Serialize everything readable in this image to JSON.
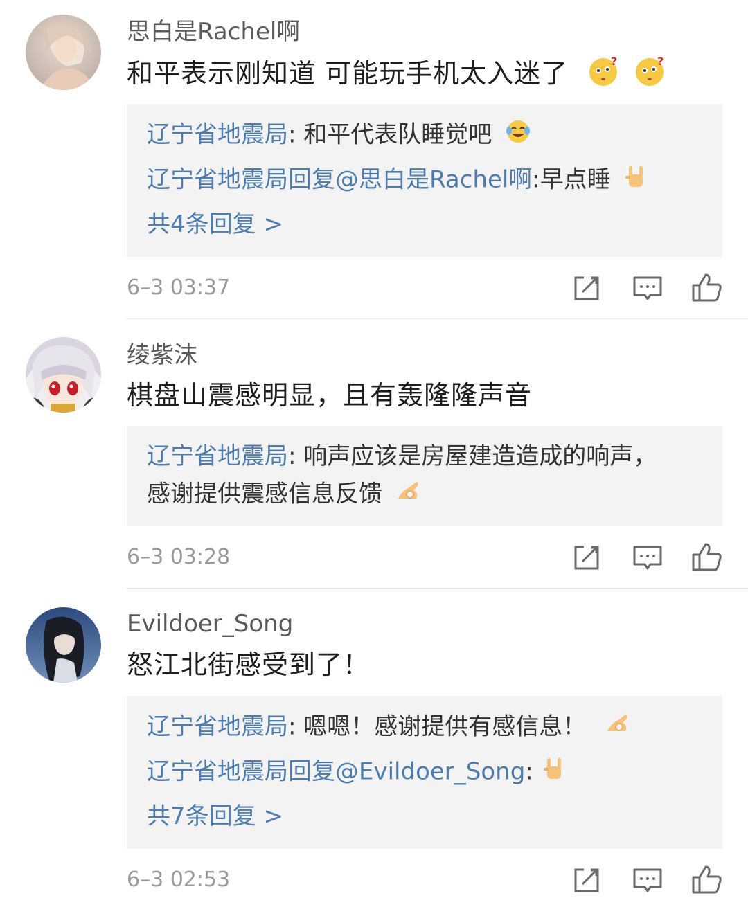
{
  "comments": [
    {
      "username": "思白是Rachel啊",
      "text": "和平表示刚知道  可能玩手机太入迷了",
      "replies": [
        {
          "name": "辽宁省地震局",
          "text": ": 和平代表队睡觉吧"
        },
        {
          "name": "辽宁省地震局回复@思白是Rachel啊",
          "text": ":早点睡"
        }
      ],
      "more_replies": "共4条回复 >",
      "timestamp": "6–3 03:37"
    },
    {
      "username": "绫紫沫",
      "text": "棋盘山震感明显，且有轰隆隆声音",
      "replies": [
        {
          "name": "辽宁省地震局",
          "text": ": 响声应该是房屋建造造成的响声，"
        },
        {
          "name": "",
          "text": "感谢提供震感信息反馈"
        }
      ],
      "timestamp": "6–3 03:28"
    },
    {
      "username": "Evildoer_Song",
      "text": "怒江北街感受到了！",
      "replies": [
        {
          "name": "辽宁省地震局",
          "text": ": 嗯嗯！感谢提供有感信息！"
        },
        {
          "name": "辽宁省地震局回复@Evildoer_Song",
          "text": ":"
        }
      ],
      "more_replies": "共7条回复 >",
      "timestamp": "6–3 02:53"
    }
  ],
  "icons": {
    "repost": "repost-icon",
    "comment": "comment-icon",
    "like": "thumbs-up-icon",
    "emojis": [
      "confused-face-emoji",
      "laughing-tears-emoji",
      "rock-hand-emoji",
      "ok-hand-emoji"
    ]
  },
  "colors": {
    "link_blue": "#4f7cae",
    "reply_bg": "#f3f3f3",
    "meta_gray": "#9a9a9a"
  }
}
